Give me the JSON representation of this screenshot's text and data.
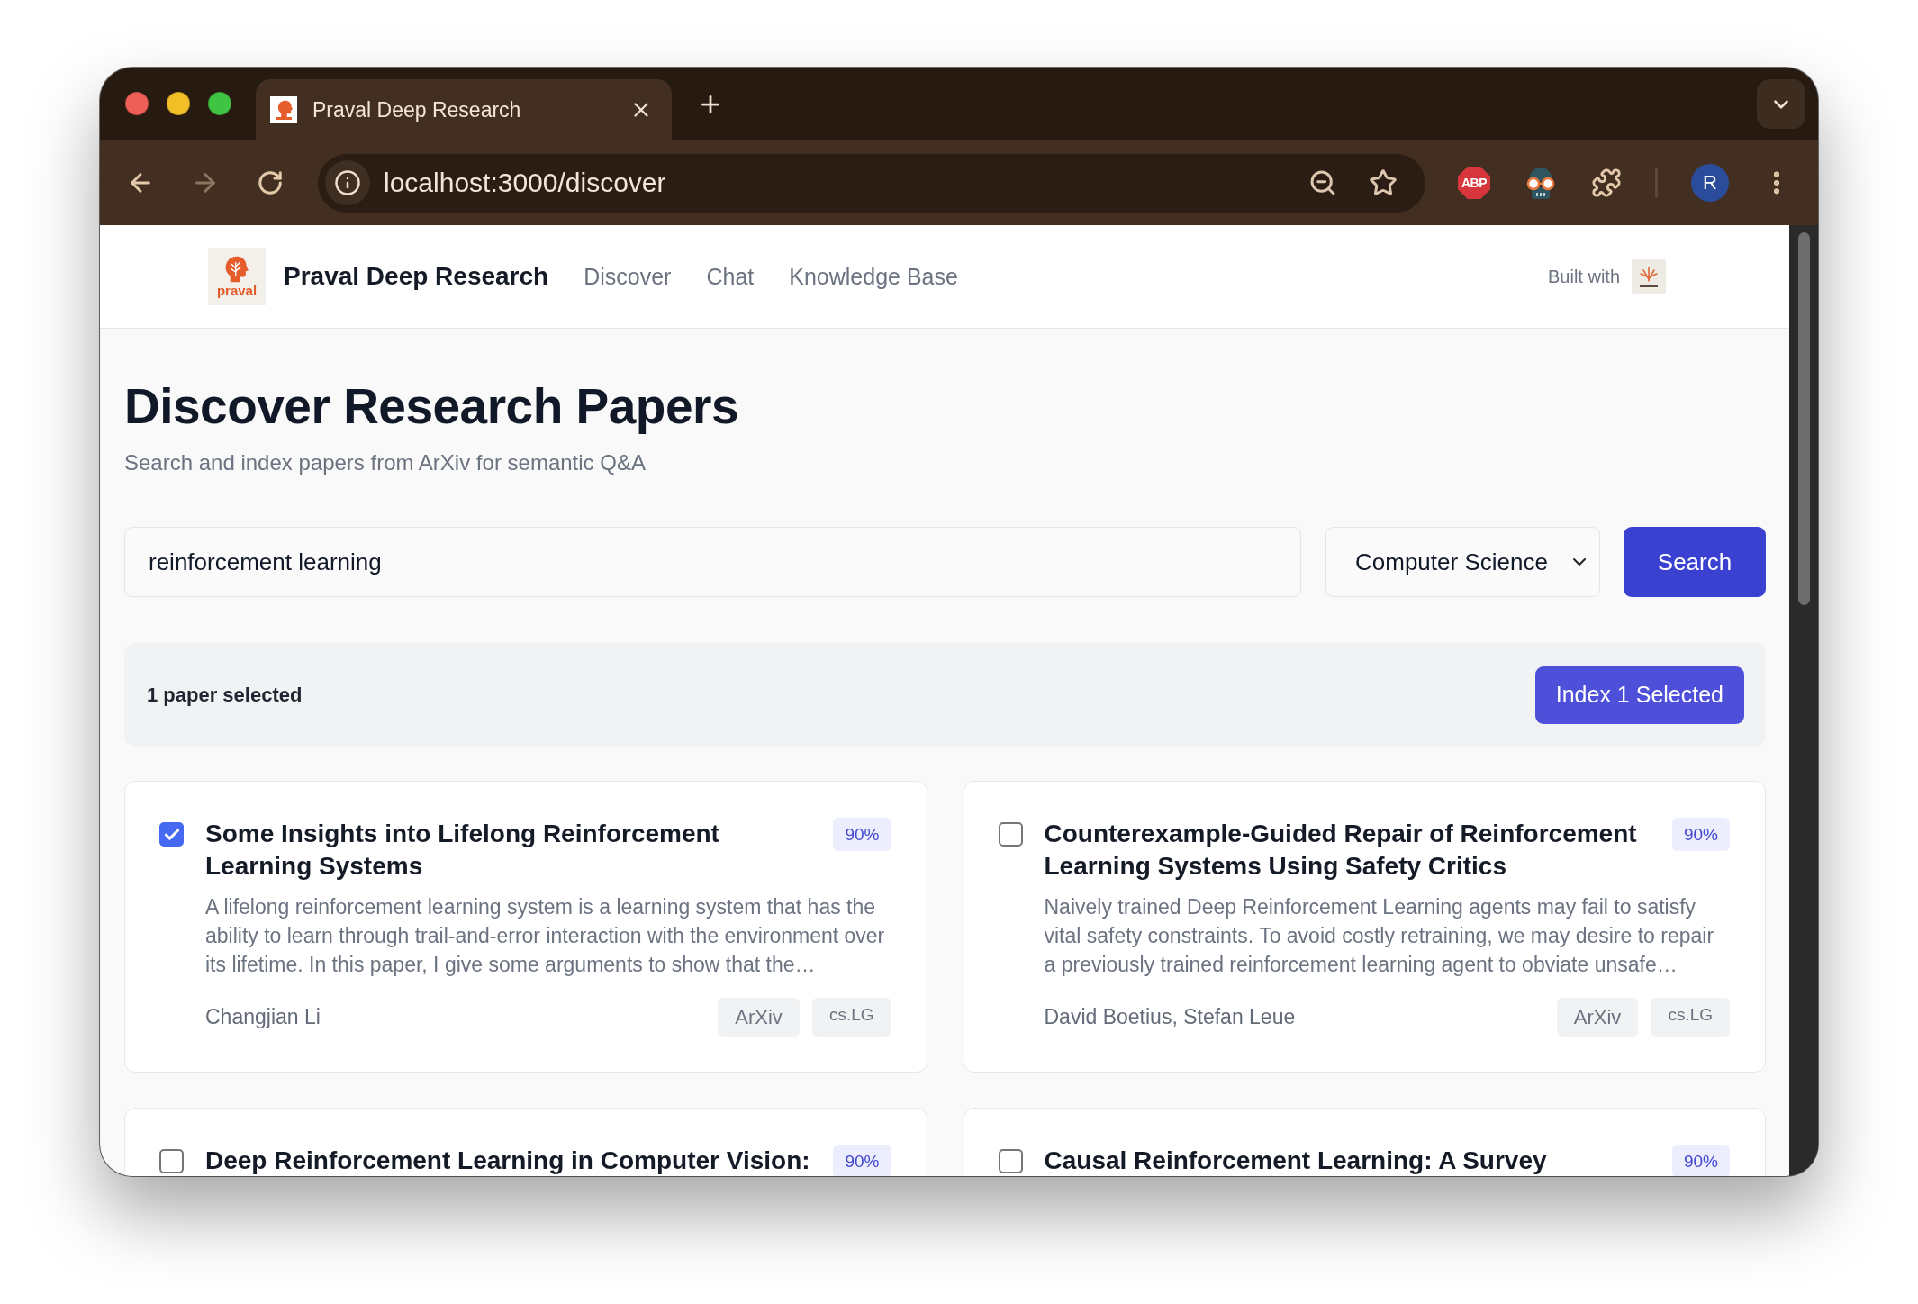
{
  "browser": {
    "tabs": [
      {
        "title": "Praval Deep Research",
        "selected": true
      }
    ],
    "address": "localhost:3000/discover",
    "extension_badge": "ABP",
    "profile_initial": "R"
  },
  "header": {
    "logo_text": "praval",
    "brand": "Praval Deep Research",
    "nav": [
      "Discover",
      "Chat",
      "Knowledge Base"
    ],
    "built_with": "Built with"
  },
  "page": {
    "title": "Discover Research Papers",
    "subtitle": "Search and index papers from ArXiv for semantic Q&A"
  },
  "search": {
    "query": "reinforcement learning",
    "category": "Computer Science",
    "button": "Search"
  },
  "selection": {
    "summary": "1 paper selected",
    "button": "Index 1 Selected"
  },
  "papers": [
    {
      "title": "Some Insights into Lifelong Reinforcement Learning Systems",
      "selected": true,
      "score": "90%",
      "abstract": "A lifelong reinforcement learning system is a learning system that has the ability to learn through trail-and-error interaction with the environment over its lifetime. In this paper, I give some arguments to show that the…",
      "authors": "Changjian Li",
      "source": "ArXiv",
      "category": "cs.LG"
    },
    {
      "title": "Counterexample-Guided Repair of Reinforcement Learning Systems Using Safety Critics",
      "selected": false,
      "score": "90%",
      "abstract": "Naively trained Deep Reinforcement Learning agents may fail to satisfy vital safety constraints. To avoid costly retraining, we may desire to repair a previously trained reinforcement learning agent to obviate unsafe…",
      "authors": "David Boetius, Stefan Leue",
      "source": "ArXiv",
      "category": "cs.LG"
    },
    {
      "title": "Deep Reinforcement Learning in Computer Vision:",
      "selected": false,
      "score": "90%"
    },
    {
      "title": "Causal Reinforcement Learning: A Survey",
      "selected": false,
      "score": "90%"
    }
  ]
}
